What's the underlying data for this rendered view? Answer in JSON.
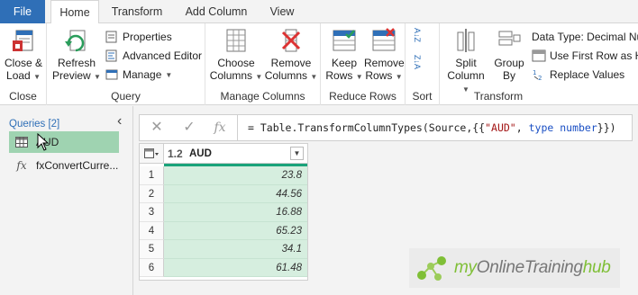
{
  "tabs": {
    "file": "File",
    "home": "Home",
    "transform": "Transform",
    "add_column": "Add Column",
    "view": "View"
  },
  "ribbon": {
    "close_group": {
      "label": "Close",
      "close_load_line1": "Close &",
      "close_load_line2": "Load"
    },
    "query_group": {
      "label": "Query",
      "refresh_line1": "Refresh",
      "refresh_line2": "Preview",
      "properties": "Properties",
      "advanced_editor": "Advanced Editor",
      "manage": "Manage"
    },
    "manage_columns_group": {
      "label": "Manage Columns",
      "choose_line1": "Choose",
      "choose_line2": "Columns",
      "remove_line1": "Remove",
      "remove_line2": "Columns"
    },
    "reduce_rows_group": {
      "label": "Reduce Rows",
      "keep_line1": "Keep",
      "keep_line2": "Rows",
      "remove_line1": "Remove",
      "remove_line2": "Rows"
    },
    "sort_group": {
      "label": "Sort",
      "asc_glyph": "A↓Z",
      "desc_glyph": "Z↓A"
    },
    "transform_group": {
      "label": "Transform",
      "split_line1": "Split",
      "split_line2": "Column",
      "group_line1": "Group",
      "group_line2": "By",
      "data_type": "Data Type: Decimal Num",
      "first_row_headers": "Use First Row as He",
      "replace_values": "Replace Values"
    }
  },
  "queries": {
    "header": "Queries [2]",
    "items": [
      {
        "label": "AUD",
        "icon": "table-icon"
      },
      {
        "label": "fxConvertCurre...",
        "icon": "function-icon"
      }
    ]
  },
  "formula_bar": {
    "cancel_glyph": "✕",
    "commit_glyph": "✓",
    "fx_glyph": "fx",
    "prefix": "= Table.TransformColumnTypes(Source,{{",
    "column_string": "\"AUD\"",
    "separator": ", ",
    "keyword_type": "type",
    "keyword_number": "number",
    "suffix": "}})"
  },
  "grid": {
    "column": {
      "type": "1.2",
      "name": "AUD"
    },
    "rows": [
      {
        "n": "1",
        "value": "23.8"
      },
      {
        "n": "2",
        "value": "44.56"
      },
      {
        "n": "3",
        "value": "16.88"
      },
      {
        "n": "4",
        "value": "65.23"
      },
      {
        "n": "5",
        "value": "34.1"
      },
      {
        "n": "6",
        "value": "61.48"
      }
    ]
  },
  "watermark": {
    "part1": "my",
    "part2": "OnlineTraining",
    "part3": "hub"
  },
  "colors": {
    "accent": "#2f6fb7",
    "selection": "#9fd3b1",
    "column_fill": "#d6eedf",
    "quality_bar": "#1aa37a",
    "brand_green": "#7fbf36"
  }
}
